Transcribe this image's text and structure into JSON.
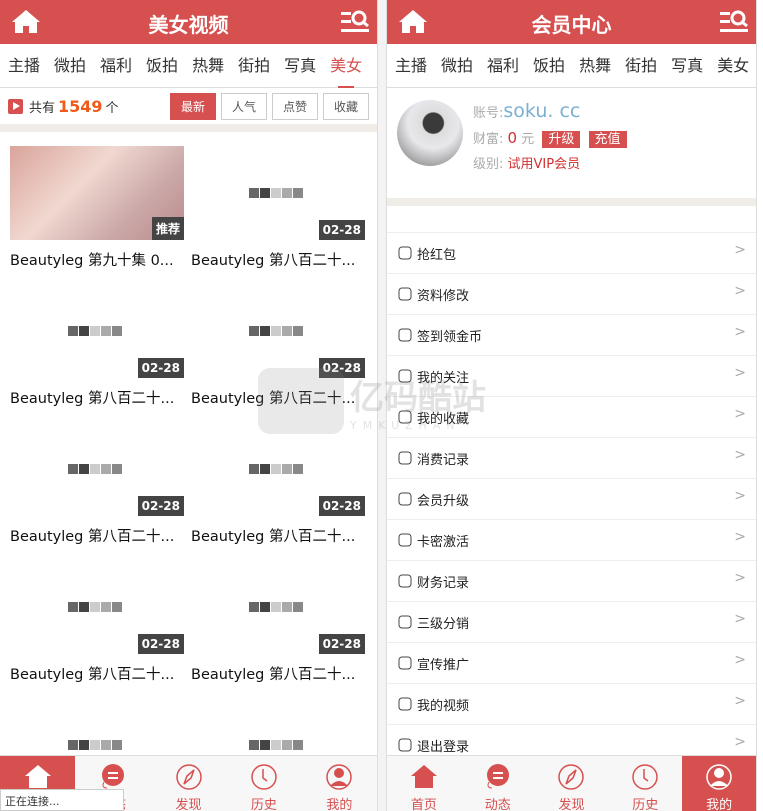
{
  "left": {
    "header": {
      "title": "美女视频",
      "home_icon": "home-icon",
      "search_icon": "search-list-icon"
    },
    "tabs": [
      "主播",
      "微拍",
      "福利",
      "饭拍",
      "热舞",
      "街拍",
      "写真",
      "美女"
    ],
    "active_tab": "美女",
    "count": {
      "prefix": "共有",
      "value": "1549",
      "suffix": "个"
    },
    "sorts": [
      "最新",
      "人气",
      "点赞",
      "收藏"
    ],
    "active_sort": "最新",
    "videos": [
      {
        "title": "Beautyleg 第九十集 0...",
        "badge": "推荐"
      },
      {
        "title": "Beautyleg 第八百二十...",
        "badge": "02-28"
      },
      {
        "title": "Beautyleg 第八百二十...",
        "badge": "02-28"
      },
      {
        "title": "Beautyleg 第八百二十...",
        "badge": "02-28"
      },
      {
        "title": "Beautyleg 第八百二十...",
        "badge": "02-28"
      },
      {
        "title": "Beautyleg 第八百二十...",
        "badge": "02-28"
      },
      {
        "title": "Beautyleg 第八百二十...",
        "badge": "02-28"
      },
      {
        "title": "Beautyleg 第八百二十...",
        "badge": "02-28"
      },
      {
        "title": "",
        "badge": ""
      },
      {
        "title": "",
        "badge": ""
      }
    ],
    "nav": [
      {
        "label": "首页"
      },
      {
        "label": "动态"
      },
      {
        "label": "发现"
      },
      {
        "label": "历史"
      },
      {
        "label": "我的"
      }
    ],
    "status": "正在连接..."
  },
  "right": {
    "header": {
      "title": "会员中心"
    },
    "tabs": [
      "主播",
      "微拍",
      "福利",
      "饭拍",
      "热舞",
      "街拍",
      "写真",
      "美女"
    ],
    "profile": {
      "account_label": "账号:",
      "account": "soku. cc",
      "wealth_label": "财富:",
      "wealth": "0",
      "unit": "元",
      "upgrade": "升级",
      "recharge": "充值",
      "level_label": "级别:",
      "level": "试用VIP会员"
    },
    "menu": [
      {
        "label": "抢红包",
        "icon": "red-packet-icon"
      },
      {
        "label": "资料修改",
        "icon": "gear-icon"
      },
      {
        "label": "签到领金币",
        "icon": "edit-icon"
      },
      {
        "label": "我的关注",
        "icon": "heart-icon"
      },
      {
        "label": "我的收藏",
        "icon": "star-icon"
      },
      {
        "label": "消费记录",
        "icon": "yen-icon"
      },
      {
        "label": "会员升级",
        "icon": "database-icon"
      },
      {
        "label": "卡密激活",
        "icon": "card-icon"
      },
      {
        "label": "财务记录",
        "icon": "document-icon"
      },
      {
        "label": "三级分销",
        "icon": "hierarchy-icon"
      },
      {
        "label": "宣传推广",
        "icon": "share-icon"
      },
      {
        "label": "我的视频",
        "icon": "video-icon"
      },
      {
        "label": "退出登录",
        "icon": "logout-icon"
      }
    ],
    "arrow": ">",
    "nav": [
      {
        "label": "首页"
      },
      {
        "label": "动态"
      },
      {
        "label": "发现"
      },
      {
        "label": "历史"
      },
      {
        "label": "我的"
      }
    ],
    "active_nav": "我的"
  },
  "watermark": {
    "text": "亿码酷站",
    "sub": "YMKUZHAN"
  },
  "colors": {
    "brand": "#d65050",
    "count": "#f05a1a"
  }
}
